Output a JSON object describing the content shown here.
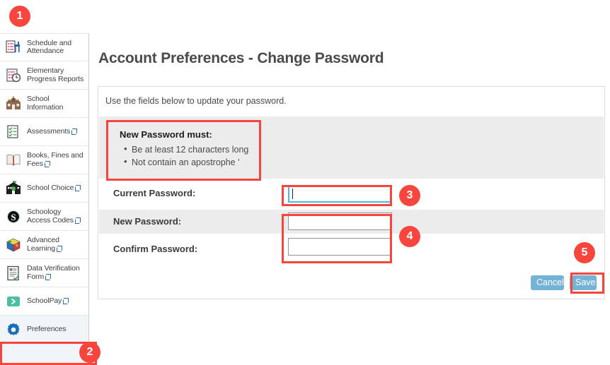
{
  "sidebar": {
    "items": [
      {
        "label": "Schedule and Attendance",
        "icon": "schedule-attendance-icon",
        "external": false,
        "highlighted": false
      },
      {
        "label": "Elementary Progress Reports",
        "icon": "progress-reports-icon",
        "external": false,
        "highlighted": false
      },
      {
        "label": "School Information",
        "icon": "school-information-icon",
        "external": false,
        "highlighted": false
      },
      {
        "label": "Assessments",
        "icon": "assessments-icon",
        "external": true,
        "highlighted": false
      },
      {
        "label": "Books, Fines and Fees",
        "icon": "books-fines-fees-icon",
        "external": true,
        "highlighted": false
      },
      {
        "label": "School Choice",
        "icon": "school-choice-icon",
        "external": true,
        "highlighted": false
      },
      {
        "label": "Schoology Access Codes",
        "icon": "schoology-icon",
        "external": true,
        "highlighted": false
      },
      {
        "label": "Advanced Learning",
        "icon": "advanced-learning-icon",
        "external": true,
        "highlighted": false
      },
      {
        "label": "Data Verification Form",
        "icon": "data-verification-icon",
        "external": true,
        "highlighted": false
      },
      {
        "label": "SchoolPay",
        "icon": "schoolpay-icon",
        "external": true,
        "highlighted": false
      },
      {
        "label": "Preferences",
        "icon": "gear-icon",
        "external": false,
        "highlighted": true
      }
    ]
  },
  "page": {
    "title": "Account Preferences - Change Password",
    "intro": "Use the fields below to update your password."
  },
  "rules": {
    "title": "New Password must:",
    "items": [
      "Be at least 12 characters long",
      "Not contain an apostrophe '"
    ]
  },
  "form": {
    "current_password": {
      "label": "Current Password:",
      "value": "",
      "placeholder": ""
    },
    "new_password": {
      "label": "New Password:",
      "value": "",
      "placeholder": ""
    },
    "confirm_password": {
      "label": "Confirm Password:",
      "value": "",
      "placeholder": ""
    }
  },
  "actions": {
    "cancel_label": "Cancel",
    "save_label": "Save"
  },
  "annotations": {
    "badges": [
      "1",
      "2",
      "3",
      "4",
      "5"
    ]
  },
  "colors": {
    "annotation_red": "#f8453d",
    "button_blue": "#74b2d8",
    "focus_blue": "#4bb8e8",
    "sidebar_bg": "#f2f5f7",
    "row_gray": "#ececed"
  }
}
